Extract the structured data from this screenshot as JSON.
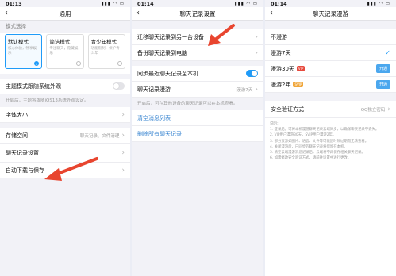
{
  "status": {
    "time1": "01:13",
    "time2": "01:14",
    "time3": "01:14"
  },
  "panel1": {
    "title": "通用",
    "mode_section": "模式选择",
    "modes": [
      {
        "title": "默认模式",
        "desc": "核心体验，畅享娱乐",
        "selected": true
      },
      {
        "title": "简洁模式",
        "desc": "专注聊天，隐藏娱乐",
        "selected": false
      },
      {
        "title": "青少年模式",
        "desc": "功能限制，保护青少年",
        "selected": false
      }
    ],
    "theme_follow": "主题模式跟随系统外观",
    "theme_note": "开启后，主题将跟随iOS13系统外观设定。",
    "font_size": "字体大小",
    "storage": "存储空间",
    "storage_value": "聊天记录、文件清理",
    "chat_settings": "聊天记录设置",
    "auto_download": "自动下载与保存"
  },
  "panel2": {
    "title": "聊天记录设置",
    "migrate": "迁移聊天记录到另一台设备",
    "backup": "备份聊天记录到电脑",
    "sync": "同步最近聊天记录至本机",
    "roam": "聊天记录漫游",
    "roam_value": "漫游7天",
    "roam_note": "开启后，可在其他设备的聊天记录可以在本机查看。",
    "clear_list": "清空消息列表",
    "delete_all": "删除所有聊天记录"
  },
  "panel3": {
    "title": "聊天记录漫游",
    "options": [
      {
        "label": "不漫游",
        "badge": "",
        "action": ""
      },
      {
        "label": "漫游7天",
        "badge": "",
        "action": "check"
      },
      {
        "label": "漫游30天",
        "badge": "VIP",
        "action": "开通"
      },
      {
        "label": "漫游2年",
        "badge": "SVIP",
        "action": "开通"
      }
    ],
    "security": "安全验证方式",
    "security_value": "QQ独立密码",
    "desc_title": "说明：",
    "desc_lines": [
      "1. 登录后，可将本机漫游聊天记录云端同步，以确保聊天记录不丢失。",
      "2. VIP用户漫游30天，SVIP用户漫游2年。",
      "3. 部分资源如图片、语音、文件等可能因时效过期而无法查看。",
      "4. 关闭漫游后，已同步的聊天记录将保留在本机。",
      "5. 清空云端漫游消息记录后，云端将不再保存相关聊天记录。",
      "6. 如需修改安全验证方式，请前往设置中进行更改。"
    ]
  },
  "colors": {
    "accent": "#1f9bf8",
    "arrow": "#e8452f"
  }
}
